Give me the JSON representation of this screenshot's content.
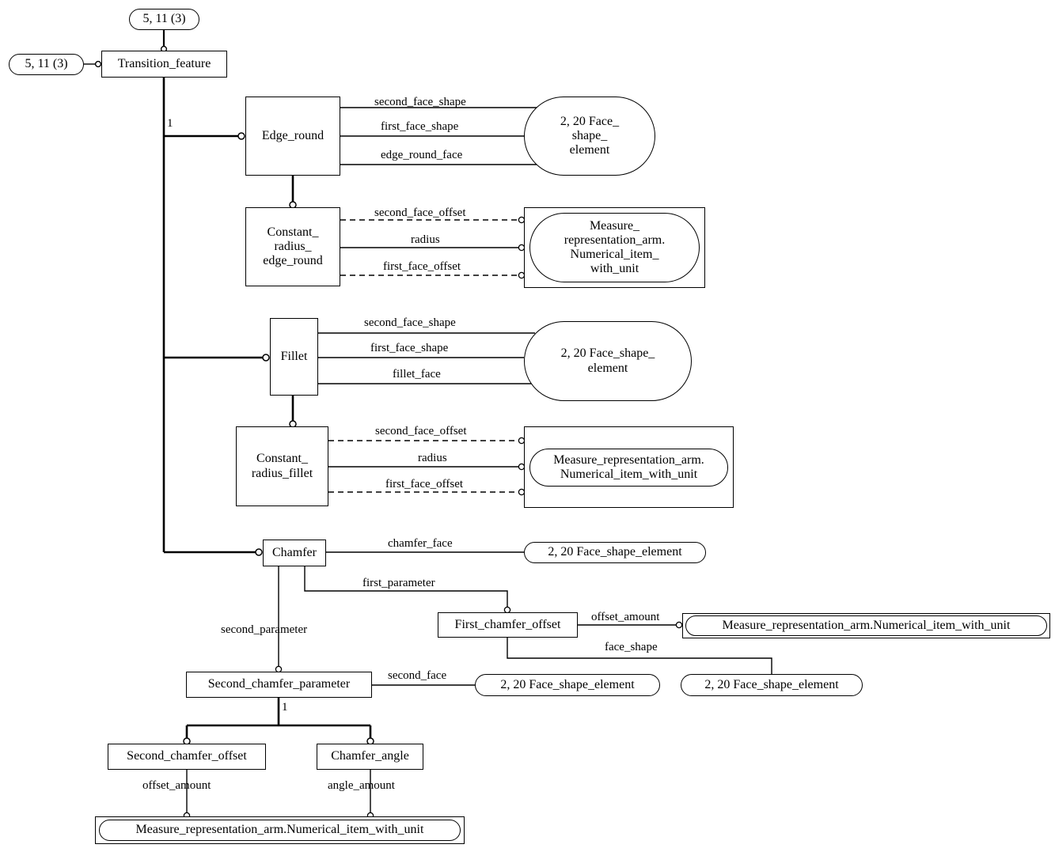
{
  "diagram": {
    "type": "EXPRESS-G entity-level diagram",
    "page_refs": [
      {
        "id": "ref_top",
        "label": "5, 11 (3)"
      },
      {
        "id": "ref_left",
        "label": "5, 11 (3)"
      }
    ],
    "entities": [
      {
        "id": "transition_feature",
        "label": "Transition_feature"
      },
      {
        "id": "edge_round",
        "label": "Edge_round"
      },
      {
        "id": "constant_radius_edge_round",
        "label": "Constant_\nradius_\nedge_round"
      },
      {
        "id": "fillet",
        "label": "Fillet"
      },
      {
        "id": "constant_radius_fillet",
        "label": "Constant_\nradius_fillet"
      },
      {
        "id": "chamfer",
        "label": "Chamfer"
      },
      {
        "id": "first_chamfer_offset",
        "label": "First_chamfer_offset"
      },
      {
        "id": "second_chamfer_parameter",
        "label": "Second_chamfer_parameter"
      },
      {
        "id": "second_chamfer_offset",
        "label": "Second_chamfer_offset"
      },
      {
        "id": "chamfer_angle",
        "label": "Chamfer_angle"
      }
    ],
    "external_refs": [
      {
        "id": "fse_edge_round",
        "label": "2, 20 Face_\nshape_\nelement"
      },
      {
        "id": "meas_edge_round",
        "label": "Measure_\nrepresentation_arm.\nNumerical_item_\nwith_unit"
      },
      {
        "id": "fse_fillet",
        "label": "2, 20 Face_shape_\nelement"
      },
      {
        "id": "meas_fillet",
        "label": "Measure_representation_arm.\nNumerical_item_with_unit"
      },
      {
        "id": "fse_chamfer",
        "label": "2, 20 Face_shape_element"
      },
      {
        "id": "meas_first_offset",
        "label": "Measure_representation_arm.Numerical_item_with_unit"
      },
      {
        "id": "fse_second_face",
        "label": "2, 20 Face_shape_element"
      },
      {
        "id": "fse_face_shape",
        "label": "2, 20 Face_shape_element"
      },
      {
        "id": "meas_bottom",
        "label": "Measure_representation_arm.Numerical_item_with_unit"
      }
    ],
    "attribute_labels": [
      {
        "id": "second_face_shape_er",
        "label": "second_face_shape"
      },
      {
        "id": "first_face_shape_er",
        "label": "first_face_shape"
      },
      {
        "id": "edge_round_face",
        "label": "edge_round_face"
      },
      {
        "id": "second_face_offset_er",
        "label": "second_face_offset"
      },
      {
        "id": "radius_er",
        "label": "radius"
      },
      {
        "id": "first_face_offset_er",
        "label": "first_face_offset"
      },
      {
        "id": "second_face_shape_f",
        "label": "second_face_shape"
      },
      {
        "id": "first_face_shape_f",
        "label": "first_face_shape"
      },
      {
        "id": "fillet_face",
        "label": "fillet_face"
      },
      {
        "id": "second_face_offset_f",
        "label": "second_face_offset"
      },
      {
        "id": "radius_f",
        "label": "radius"
      },
      {
        "id": "first_face_offset_f",
        "label": "first_face_offset"
      },
      {
        "id": "chamfer_face",
        "label": "chamfer_face"
      },
      {
        "id": "first_parameter",
        "label": "first_parameter"
      },
      {
        "id": "second_parameter",
        "label": "second_parameter"
      },
      {
        "id": "offset_amount_first",
        "label": "offset_amount"
      },
      {
        "id": "face_shape",
        "label": "face_shape"
      },
      {
        "id": "second_face",
        "label": "second_face"
      },
      {
        "id": "offset_amount_second",
        "label": "offset_amount"
      },
      {
        "id": "angle_amount",
        "label": "angle_amount"
      }
    ],
    "cardinalities": [
      {
        "id": "card_transition",
        "label": "1"
      },
      {
        "id": "card_second_param",
        "label": "1"
      }
    ]
  }
}
